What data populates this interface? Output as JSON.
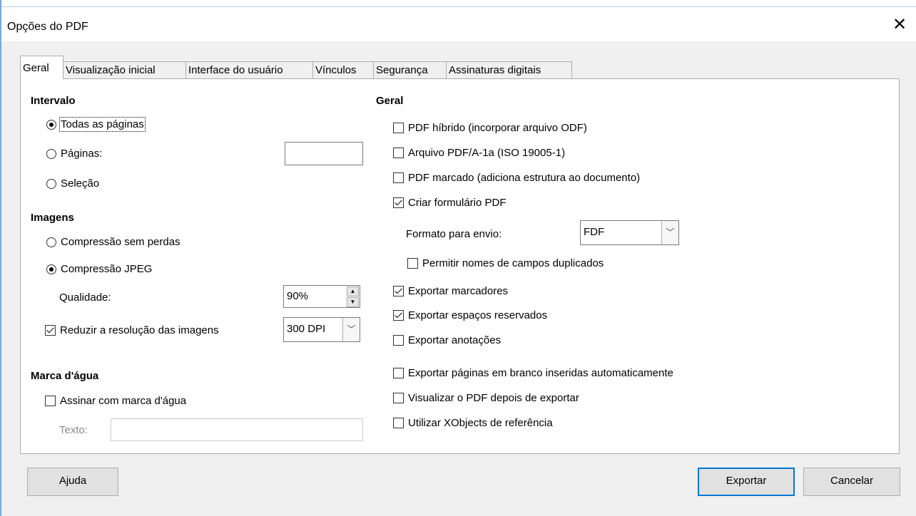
{
  "window": {
    "title": "Opções do PDF",
    "close_icon": "close-icon"
  },
  "tabs": [
    {
      "label": "Geral",
      "active": true
    },
    {
      "label": "Visualização inicial"
    },
    {
      "label": "Interface do usuário"
    },
    {
      "label": "Vínculos"
    },
    {
      "label": "Segurança"
    },
    {
      "label": "Assinaturas digitais"
    }
  ],
  "intervalo": {
    "heading": "Intervalo",
    "todas": "Todas as páginas",
    "paginas": "Páginas:",
    "paginas_value": "",
    "selecao": "Seleção",
    "selected": "todas"
  },
  "imagens": {
    "heading": "Imagens",
    "sem_perdas": "Compressão sem perdas",
    "jpeg": "Compressão JPEG",
    "selected": "jpeg",
    "qualidade_label": "Qualidade:",
    "qualidade_value": "90%",
    "reduzir_label": "Reduzir a resolução das imagens",
    "reduzir_checked": true,
    "dpi_value": "300 DPI"
  },
  "marca": {
    "heading": "Marca d'água",
    "assinar": "Assinar com marca d'água",
    "assinar_checked": false,
    "texto_label": "Texto:",
    "texto_value": ""
  },
  "geral": {
    "heading": "Geral",
    "hibrido": "PDF híbrido (incorporar arquivo ODF)",
    "pdfa": "Arquivo PDF/A-1a (ISO 19005-1)",
    "marcado": "PDF marcado (adiciona estrutura ao documento)",
    "formulario": "Criar formulário PDF",
    "formato_label": "Formato para envio:",
    "formato_value": "FDF",
    "duplicados": "Permitir nomes de campos duplicados",
    "marcadores": "Exportar marcadores",
    "espacos": "Exportar espaços reservados",
    "anotacoes": "Exportar anotações",
    "brancas": "Exportar páginas em branco inseridas automaticamente",
    "visualizar": "Visualizar o PDF depois de exportar",
    "xobjects": "Utilizar XObjects de referência"
  },
  "checked": {
    "hibrido": false,
    "pdfa": false,
    "marcado": false,
    "formulario": true,
    "duplicados": false,
    "marcadores": true,
    "espacos": true,
    "anotacoes": false,
    "brancas": false,
    "visualizar": false,
    "xobjects": false
  },
  "buttons": {
    "ajuda": "Ajuda",
    "exportar": "Exportar",
    "cancelar": "Cancelar"
  }
}
